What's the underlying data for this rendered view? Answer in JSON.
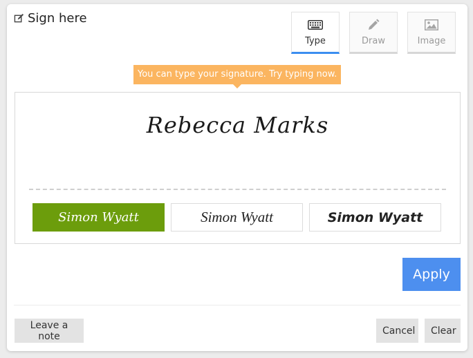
{
  "dialog": {
    "title": "Sign here",
    "tabs": [
      {
        "label": "Type",
        "icon": "keyboard-icon",
        "active": true
      },
      {
        "label": "Draw",
        "icon": "pencil-icon",
        "active": false
      },
      {
        "label": "Image",
        "icon": "image-icon",
        "active": false
      }
    ],
    "tooltip": "You can type your signature. Try typing now.",
    "signature": {
      "text": "Rebecca Marks",
      "style_options": [
        "Simon Wyatt",
        "Simon Wyatt",
        "Simon Wyatt"
      ],
      "selected_index": 0
    },
    "buttons": {
      "apply": "Apply",
      "leave_note": "Leave a note",
      "cancel": "Cancel",
      "clear": "Clear"
    },
    "colors": {
      "accent_blue": "#4d8fef",
      "tooltip_orange": "#fbb560",
      "selected_green": "#6c9d0c"
    }
  }
}
